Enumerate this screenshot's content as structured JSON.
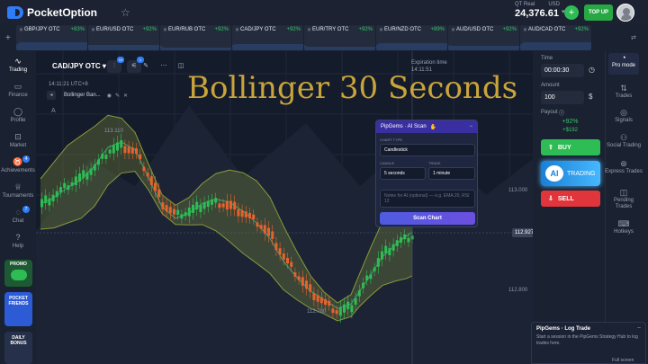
{
  "app": {
    "name": "PocketOption",
    "account_label": "QT Real",
    "currency": "USD",
    "balance": "24,376.61",
    "top_up_label": "TOP UP"
  },
  "ticker": [
    {
      "name": "GBP/JPY OTC",
      "pct": "+83%"
    },
    {
      "name": "EUR/USD OTC",
      "pct": "+92%"
    },
    {
      "name": "EUR/RUB OTC",
      "pct": "+92%"
    },
    {
      "name": "CAD/JPY OTC",
      "pct": "+92%"
    },
    {
      "name": "EUR/TRY OTC",
      "pct": "+92%"
    },
    {
      "name": "EUR/NZD OTC",
      "pct": "+89%"
    },
    {
      "name": "AUD/USD OTC",
      "pct": "+92%"
    },
    {
      "name": "AUD/CAD OTC",
      "pct": "+92%"
    }
  ],
  "sidebar": {
    "items": [
      {
        "label": "Trading",
        "icon": "chart-icon"
      },
      {
        "label": "Finance",
        "icon": "wallet-icon"
      },
      {
        "label": "Profile",
        "icon": "user-icon"
      },
      {
        "label": "Market",
        "icon": "cart-icon"
      },
      {
        "label": "Achievements",
        "icon": "trophy-icon",
        "badge": "4"
      },
      {
        "label": "Tournaments",
        "icon": "cup-icon"
      },
      {
        "label": "Chat",
        "icon": "chat-icon",
        "badge": "7"
      },
      {
        "label": "Help",
        "icon": "help-icon"
      }
    ],
    "promo_label": "PROMO",
    "friends_label": "POCKET FRIENDS",
    "daily_label": "DAILY BONUS"
  },
  "chart": {
    "asset": "CAD/JPY OTC",
    "tool_badge_1": "10",
    "tool_badge_2": "1",
    "clock": "14:11:21 UTC+8",
    "indicator": "Bollinger Ban...",
    "expiration_label": "Expiration time",
    "expiration_value": "14:11:51",
    "overlay_title": "Bollinger 30 Seconds",
    "price_current": "112.927",
    "price_levels": [
      "113.000",
      "112.800"
    ],
    "high_label": "113.110",
    "low_label": "112.780",
    "letter_a": "A"
  },
  "scan_panel": {
    "title": "PipGems · AI Scan",
    "chart_type_label": "CHART TYPE",
    "chart_type_value": "Candlestick",
    "candle_label": "CANDLE",
    "candle_value": "5 seconds",
    "trade_label": "TRADE",
    "trade_value": "1 minute",
    "notes_placeholder": "Notes for AI (optional) — e.g. EMA 20, RSI 12",
    "button_label": "Scan Chart"
  },
  "trade_panel": {
    "time_label": "Time",
    "time_value": "00:00:30",
    "amount_label": "Amount",
    "amount_value": "100",
    "payout_label": "Payout",
    "payout_pct": "+92%",
    "payout_amount": "+$192",
    "buy_label": "BUY",
    "ai_badge": "AI",
    "ai_label": "TRADING",
    "sell_label": "SELL"
  },
  "rail": {
    "pro_label": "Pro mode",
    "items": [
      {
        "label": "Trades",
        "icon": "trades-icon"
      },
      {
        "label": "Signals",
        "icon": "signals-icon"
      },
      {
        "label": "Social Trading",
        "icon": "social-icon"
      },
      {
        "label": "Express Trades",
        "icon": "express-icon"
      },
      {
        "label": "Pending Trades",
        "icon": "pending-icon"
      },
      {
        "label": "Hotkeys",
        "icon": "hotkeys-icon"
      }
    ]
  },
  "log_trade": {
    "title": "PipGems · Log Trade",
    "body": "Start a session in the PipGems Strategy Hub to log trades here.",
    "fullscreen": "Full screen"
  },
  "colors": {
    "up": "#2ebd55",
    "down": "#e8622c",
    "band_fill": "#7a8a3a",
    "mid_line": "#3aa67a"
  }
}
